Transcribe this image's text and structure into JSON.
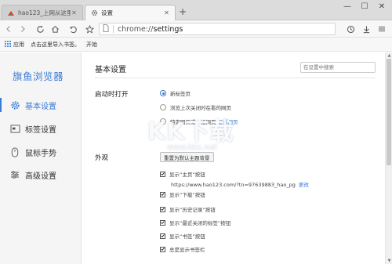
{
  "tabs": [
    {
      "title": "hao123_上网从这里开始",
      "active": false,
      "favicon": "hao123-icon"
    },
    {
      "title": "设置",
      "active": true,
      "favicon": "gear-icon"
    }
  ],
  "window_controls": {
    "minimize": "—",
    "maximize": "☐",
    "close": "✕"
  },
  "toolbar": {
    "url_scheme": "chrome://",
    "url_path": "settings"
  },
  "bookmarks_bar": {
    "apps_label": "应用",
    "import_label": "点击这里导入书签。",
    "start_label": "开始"
  },
  "sidebar": {
    "brand": "旗鱼浏览器",
    "items": [
      {
        "label": "基本设置",
        "icon": "gear-icon",
        "active": true
      },
      {
        "label": "标签设置",
        "icon": "tab-icon",
        "active": false
      },
      {
        "label": "鼠标手势",
        "icon": "mouse-icon",
        "active": false
      },
      {
        "label": "高级设置",
        "icon": "sliders-icon",
        "active": false
      }
    ]
  },
  "main": {
    "section_title": "基本设置",
    "search_placeholder": "在设置中搜索",
    "startup": {
      "label": "启动时打开",
      "options": [
        {
          "label": "新标签页",
          "checked": true
        },
        {
          "label": "浏览上次关闭时在看的网页",
          "checked": false
        },
        {
          "label": "特定网页或一组网页",
          "checked": false,
          "link": "设置网页"
        }
      ]
    },
    "appearance": {
      "label": "外观",
      "reset_theme_button": "重置为默认主题背景",
      "home_url": "https://www.hao123.com/?tn=97639883_hao_pg",
      "home_change_link": "更改",
      "checkboxes": [
        {
          "label": "显示“主页”按钮",
          "checked": true
        },
        {
          "label": "显示“下载”按钮",
          "checked": true
        },
        {
          "label": "显示“历史记录”按钮",
          "checked": true
        },
        {
          "label": "显示“最近关闭的标签”按钮",
          "checked": true
        },
        {
          "label": "显示“书签”按钮",
          "checked": true
        },
        {
          "label": "总是显示书签栏",
          "checked": true
        }
      ]
    }
  },
  "watermark": {
    "main": "KK下载",
    "sub": "www.kkx.net"
  },
  "colors": {
    "accent": "#3a7bd5",
    "sidebar_bg": "#f5f5f5",
    "toolbar_bg": "#f7f7f7"
  }
}
